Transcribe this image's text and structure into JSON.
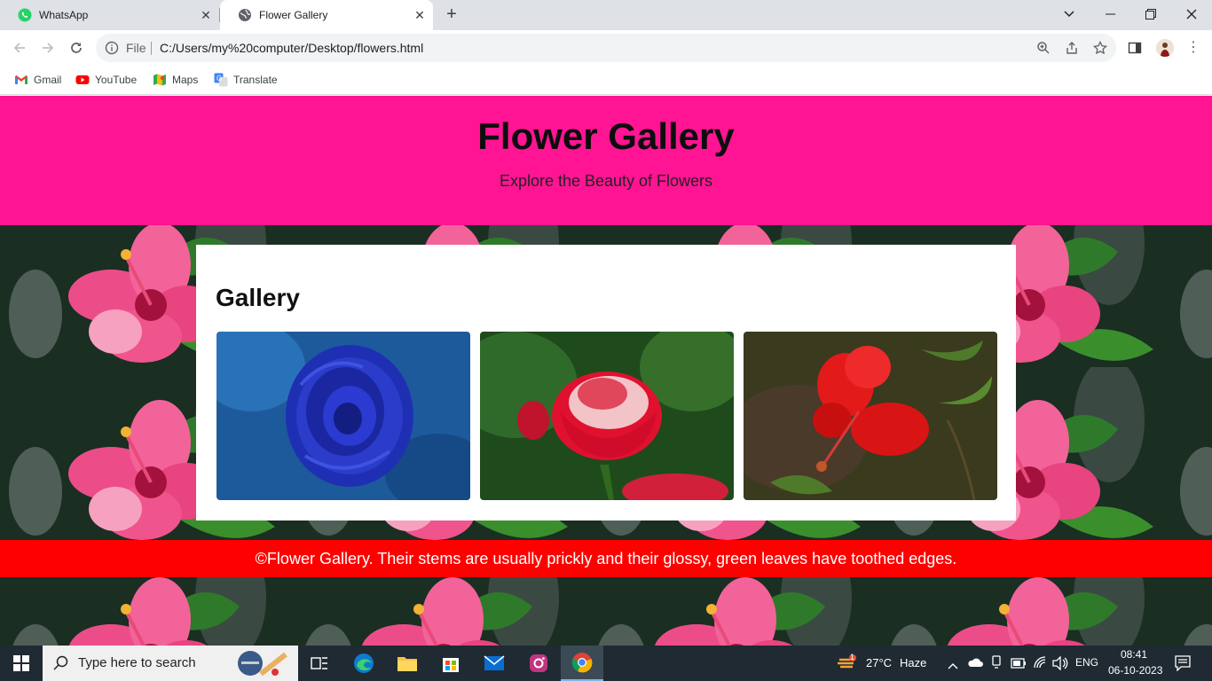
{
  "browser": {
    "tabs": [
      {
        "title": "WhatsApp",
        "active": false,
        "icon": "whatsapp-icon"
      },
      {
        "title": "Flower Gallery",
        "active": true,
        "icon": "globe-icon"
      }
    ],
    "address": {
      "scheme_label": "File",
      "url": "C:/Users/my%20computer/Desktop/flowers.html"
    },
    "bookmarks": [
      {
        "label": "Gmail",
        "icon": "gmail-icon"
      },
      {
        "label": "YouTube",
        "icon": "youtube-icon"
      },
      {
        "label": "Maps",
        "icon": "maps-icon"
      },
      {
        "label": "Translate",
        "icon": "translate-icon"
      }
    ]
  },
  "page": {
    "header": {
      "title": "Flower Gallery",
      "tagline": "Explore the Beauty of Flowers",
      "bg_color": "#ff1493"
    },
    "gallery": {
      "heading": "Gallery",
      "photos": [
        {
          "subject": "blue rose with water droplets"
        },
        {
          "subject": "red and white rose"
        },
        {
          "subject": "red hibiscus"
        }
      ]
    },
    "footer": {
      "text": "©Flower Gallery. Their stems are usually prickly and their glossy, green leaves have toothed edges.",
      "bg_color": "#ff0000"
    }
  },
  "taskbar": {
    "search_placeholder": "Type here to search",
    "weather": {
      "temp": "27°C",
      "condition": "Haze",
      "badge": "1"
    },
    "language": "ENG",
    "time": "08:41",
    "date": "06-10-2023"
  }
}
